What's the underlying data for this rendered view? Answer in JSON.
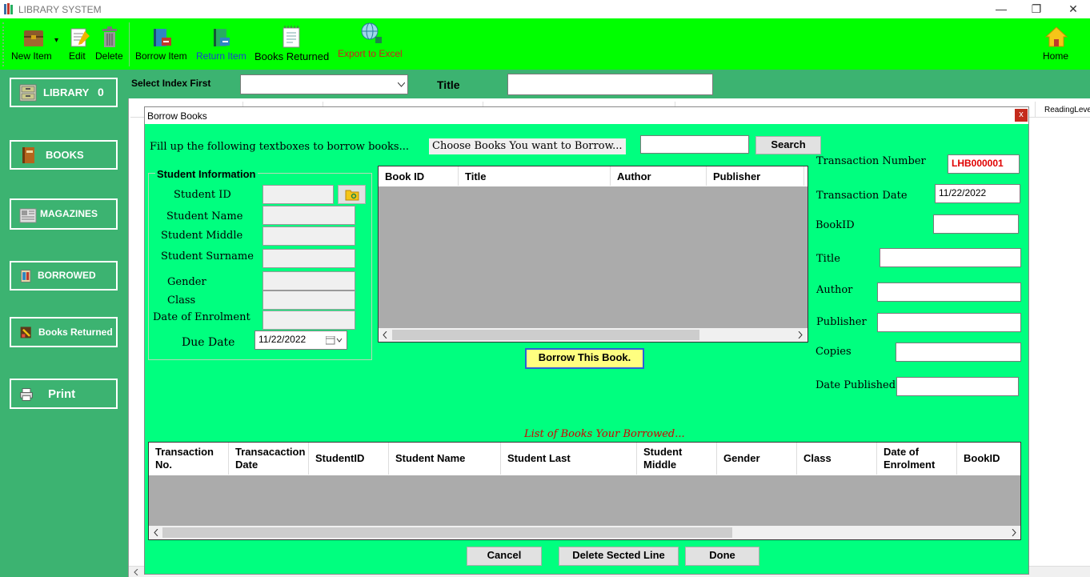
{
  "window": {
    "title": "LIBRARY SYSTEM",
    "minimize": "—",
    "restore": "❐",
    "close": "✕"
  },
  "toolbar": {
    "new_item": "New Item",
    "new_item_arrow": "▾",
    "edit": "Edit",
    "delete": "Delete",
    "borrow_item": "Borrow Item",
    "return_item": "Return Item",
    "books_returned": "Books Returned",
    "export_excel": "Export to Excel",
    "home": "Home"
  },
  "sidebar": {
    "library": "LIBRARY",
    "library_count": "0",
    "books": "BOOKS",
    "magazines": "MAGAZINES",
    "borrowed": "BORROWED",
    "books_returned": "Books Returned",
    "print": "Print"
  },
  "topbar": {
    "index_label": "Select Index First",
    "index_value": "",
    "title_label": "Title",
    "title_value": ""
  },
  "background_grid": {
    "visible_header": "ReadingLeve"
  },
  "dialog": {
    "title": "Borrow Books",
    "close": "x",
    "instructions": "Fill up the following textboxes to borrow books...",
    "choose_label": "Choose Books You want to Borrow...",
    "search_value": "",
    "search_button": "Search",
    "student_group": "Student Information",
    "student_id_label": "Student ID",
    "student_name_label": "Student Name",
    "student_middle_label": "Student Middle",
    "student_surname_label": "Student Surname",
    "gender_label": "Gender",
    "class_label": "Class",
    "enrolment_label": "Date of Enrolment",
    "due_date_label": "Due Date",
    "due_date_value": "11/22/2022",
    "book_grid_columns": [
      "Book ID",
      "Title",
      "Author",
      "Publisher"
    ],
    "borrow_button": "Borrow This Book.",
    "transaction_number_label": "Transaction Number",
    "transaction_number_value": "LHB000001",
    "transaction_date_label": "Transaction Date",
    "transaction_date_value": "11/22/2022",
    "bookid_label": "BookID",
    "title_label": "Title",
    "author_label": "Author",
    "publisher_label": "Publisher",
    "copies_label": "Copies",
    "date_published_label": "Date Published",
    "list_caption": "List of Books Your Borrowed...",
    "borrowed_grid_columns": [
      "Transaction No.",
      "Transacaction Date",
      "StudentID",
      "Student Name",
      "Student Last",
      "Student Middle",
      "Gender",
      "Class",
      "Date of Enrolment",
      "BookID"
    ],
    "cancel_button": "Cancel",
    "delete_line_button": "Delete Sected Line",
    "done_button": "Done"
  },
  "colors": {
    "toolbar_bg": "#00ff00",
    "sidebar_bg": "#3cb371",
    "dialog_bg": "#00ff7f",
    "transaction_number_text": "#e00000",
    "list_caption_text": "#d40000"
  }
}
